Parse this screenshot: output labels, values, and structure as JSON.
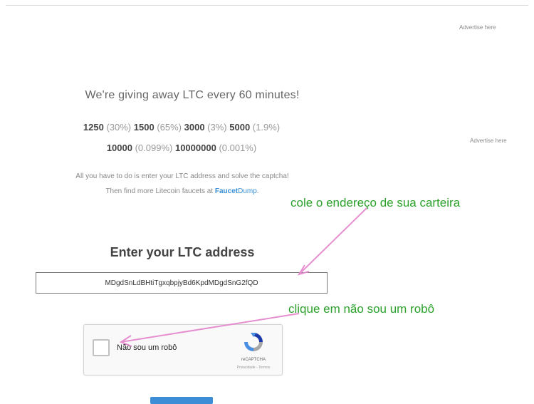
{
  "ads": {
    "top": "Advertise here",
    "side": "Advertise here"
  },
  "headline": "We're giving away LTC every 60 minutes!",
  "odds": [
    {
      "amount": "1250",
      "chance": "(30%)"
    },
    {
      "amount": "1500",
      "chance": "(65%)"
    },
    {
      "amount": "3000",
      "chance": "(3%)"
    },
    {
      "amount": "5000",
      "chance": "(1.9%)"
    },
    {
      "amount": "10000",
      "chance": "(0.099%)"
    },
    {
      "amount": "10000000",
      "chance": "(0.001%)"
    }
  ],
  "info": {
    "line1": "All you have to do is enter your LTC address and solve the captcha!",
    "line2_prefix": "Then find more Litecoin faucets at ",
    "link_part1": "Faucet",
    "link_part2": "Dump",
    "line2_suffix": "."
  },
  "annotations": {
    "paste_wallet": "cole o endereço de sua carteira",
    "click_not_robot": "clique em não sou um robô"
  },
  "form": {
    "title": "Enter your LTC address",
    "address_value": "MDgdSnLdBHtiTgxqbpjyBd6KpdMDgdSnG2fQD"
  },
  "captcha": {
    "checkbox_label": "Não sou um robô",
    "brand": "reCAPTCHA",
    "links": "Privacidade - Termos"
  },
  "colors": {
    "annotation": "#2ca12c",
    "arrow": "#e58fd0",
    "link": "#3a8fd6"
  }
}
